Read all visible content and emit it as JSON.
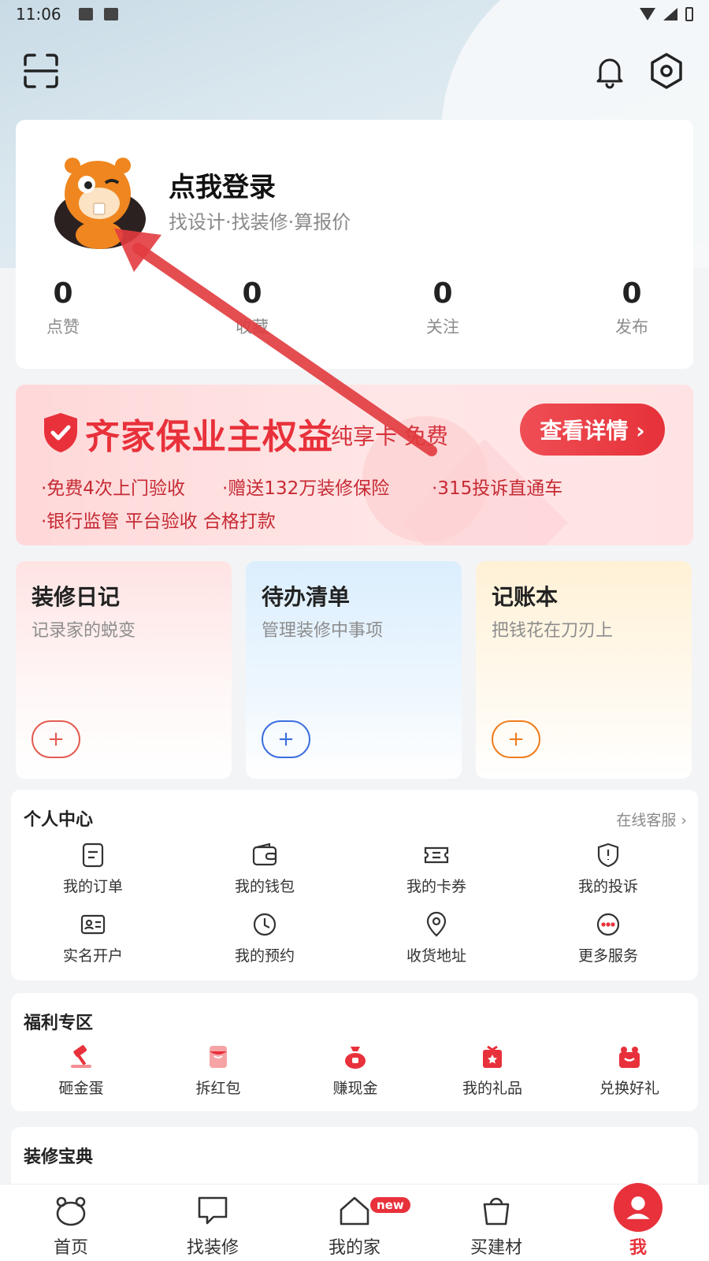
{
  "status_bar": {
    "time": "11:06"
  },
  "profile": {
    "title": "点我登录",
    "subtitle": "找设计·找装修·算报价",
    "stats": [
      {
        "value": "0",
        "label": "点赞"
      },
      {
        "value": "0",
        "label": "收藏"
      },
      {
        "value": "0",
        "label": "关注"
      },
      {
        "value": "0",
        "label": "发布"
      }
    ]
  },
  "promo": {
    "title": "齐家保业主权益",
    "subtitle": "纯享卡  免费",
    "button": "查看详情 ›",
    "features": [
      "·免费4次上门验收",
      "·赠送132万装修保险",
      "·315投诉直通车",
      "·银行监管 平台验收 合格打款"
    ]
  },
  "tools": [
    {
      "title": "装修日记",
      "subtitle": "记录家的蜕变",
      "add": "+"
    },
    {
      "title": "待办清单",
      "subtitle": "管理装修中事项",
      "add": "+"
    },
    {
      "title": "记账本",
      "subtitle": "把钱花在刀刃上",
      "add": "+"
    }
  ],
  "personal_center": {
    "title": "个人中心",
    "link": "在线客服 ›",
    "items": [
      {
        "label": "我的订单",
        "icon": "order-icon"
      },
      {
        "label": "我的钱包",
        "icon": "wallet-icon"
      },
      {
        "label": "我的卡券",
        "icon": "coupon-icon"
      },
      {
        "label": "我的投诉",
        "icon": "complaint-icon"
      },
      {
        "label": "实名开户",
        "icon": "id-card-icon"
      },
      {
        "label": "我的预约",
        "icon": "clock-icon"
      },
      {
        "label": "收货地址",
        "icon": "location-icon"
      },
      {
        "label": "更多服务",
        "icon": "more-icon"
      }
    ]
  },
  "welfare": {
    "title": "福利专区",
    "items": [
      {
        "label": "砸金蛋",
        "icon": "hammer-icon"
      },
      {
        "label": "拆红包",
        "icon": "red-envelope-icon"
      },
      {
        "label": "赚现金",
        "icon": "money-bag-icon"
      },
      {
        "label": "我的礼品",
        "icon": "gift-icon"
      },
      {
        "label": "兑换好礼",
        "icon": "exchange-gift-icon"
      }
    ]
  },
  "guide": {
    "title": "装修宝典"
  },
  "tabbar": {
    "items": [
      {
        "label": "首页"
      },
      {
        "label": "找装修"
      },
      {
        "label": "我的家",
        "badge": "new"
      },
      {
        "label": "买建材"
      },
      {
        "label": "我"
      }
    ]
  },
  "colors": {
    "accent": "#e8313b",
    "blue": "#3d6ee0",
    "orange": "#f07d1c"
  }
}
